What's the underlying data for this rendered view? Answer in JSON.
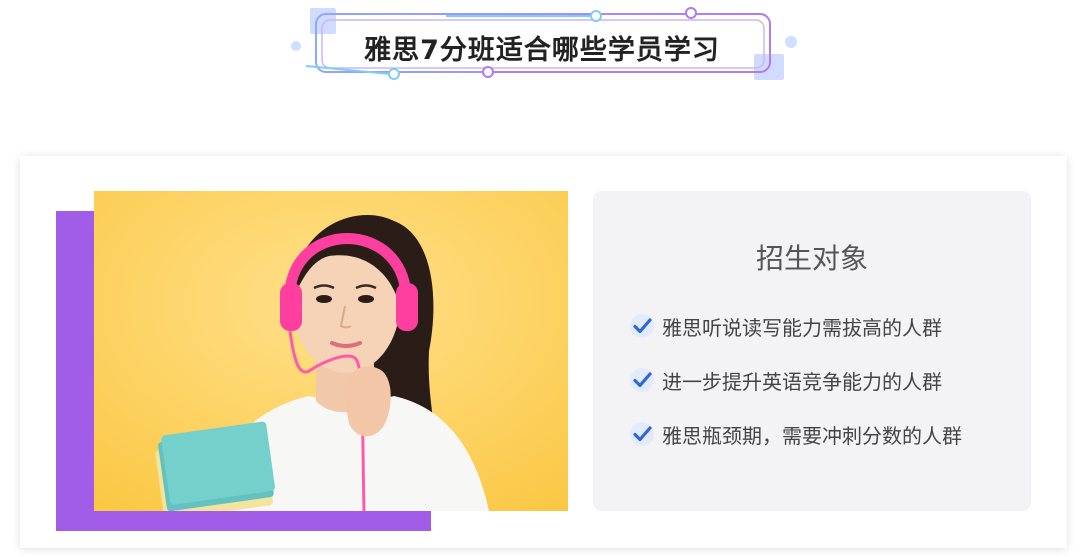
{
  "section": {
    "title": "雅思7分班适合哪些学员学习"
  },
  "panel": {
    "title": "招生对象",
    "items": [
      {
        "icon": "check-icon",
        "label": "雅思听说读写能力需拔高的人群"
      },
      {
        "icon": "check-icon",
        "label": "进一步提升英语竞争能力的人群"
      },
      {
        "icon": "check-icon",
        "label": "雅思瓶颈期，需要冲刺分数的人群"
      }
    ]
  },
  "photo": {
    "subject": "student-with-headphones-photo"
  },
  "colors": {
    "accent_purple": "#a25de8",
    "photo_bg": "#fdd15a",
    "frame_line": "#9b7bf0",
    "check_blue": "#2f66d8",
    "panel_bg": "#f3f3f5"
  }
}
